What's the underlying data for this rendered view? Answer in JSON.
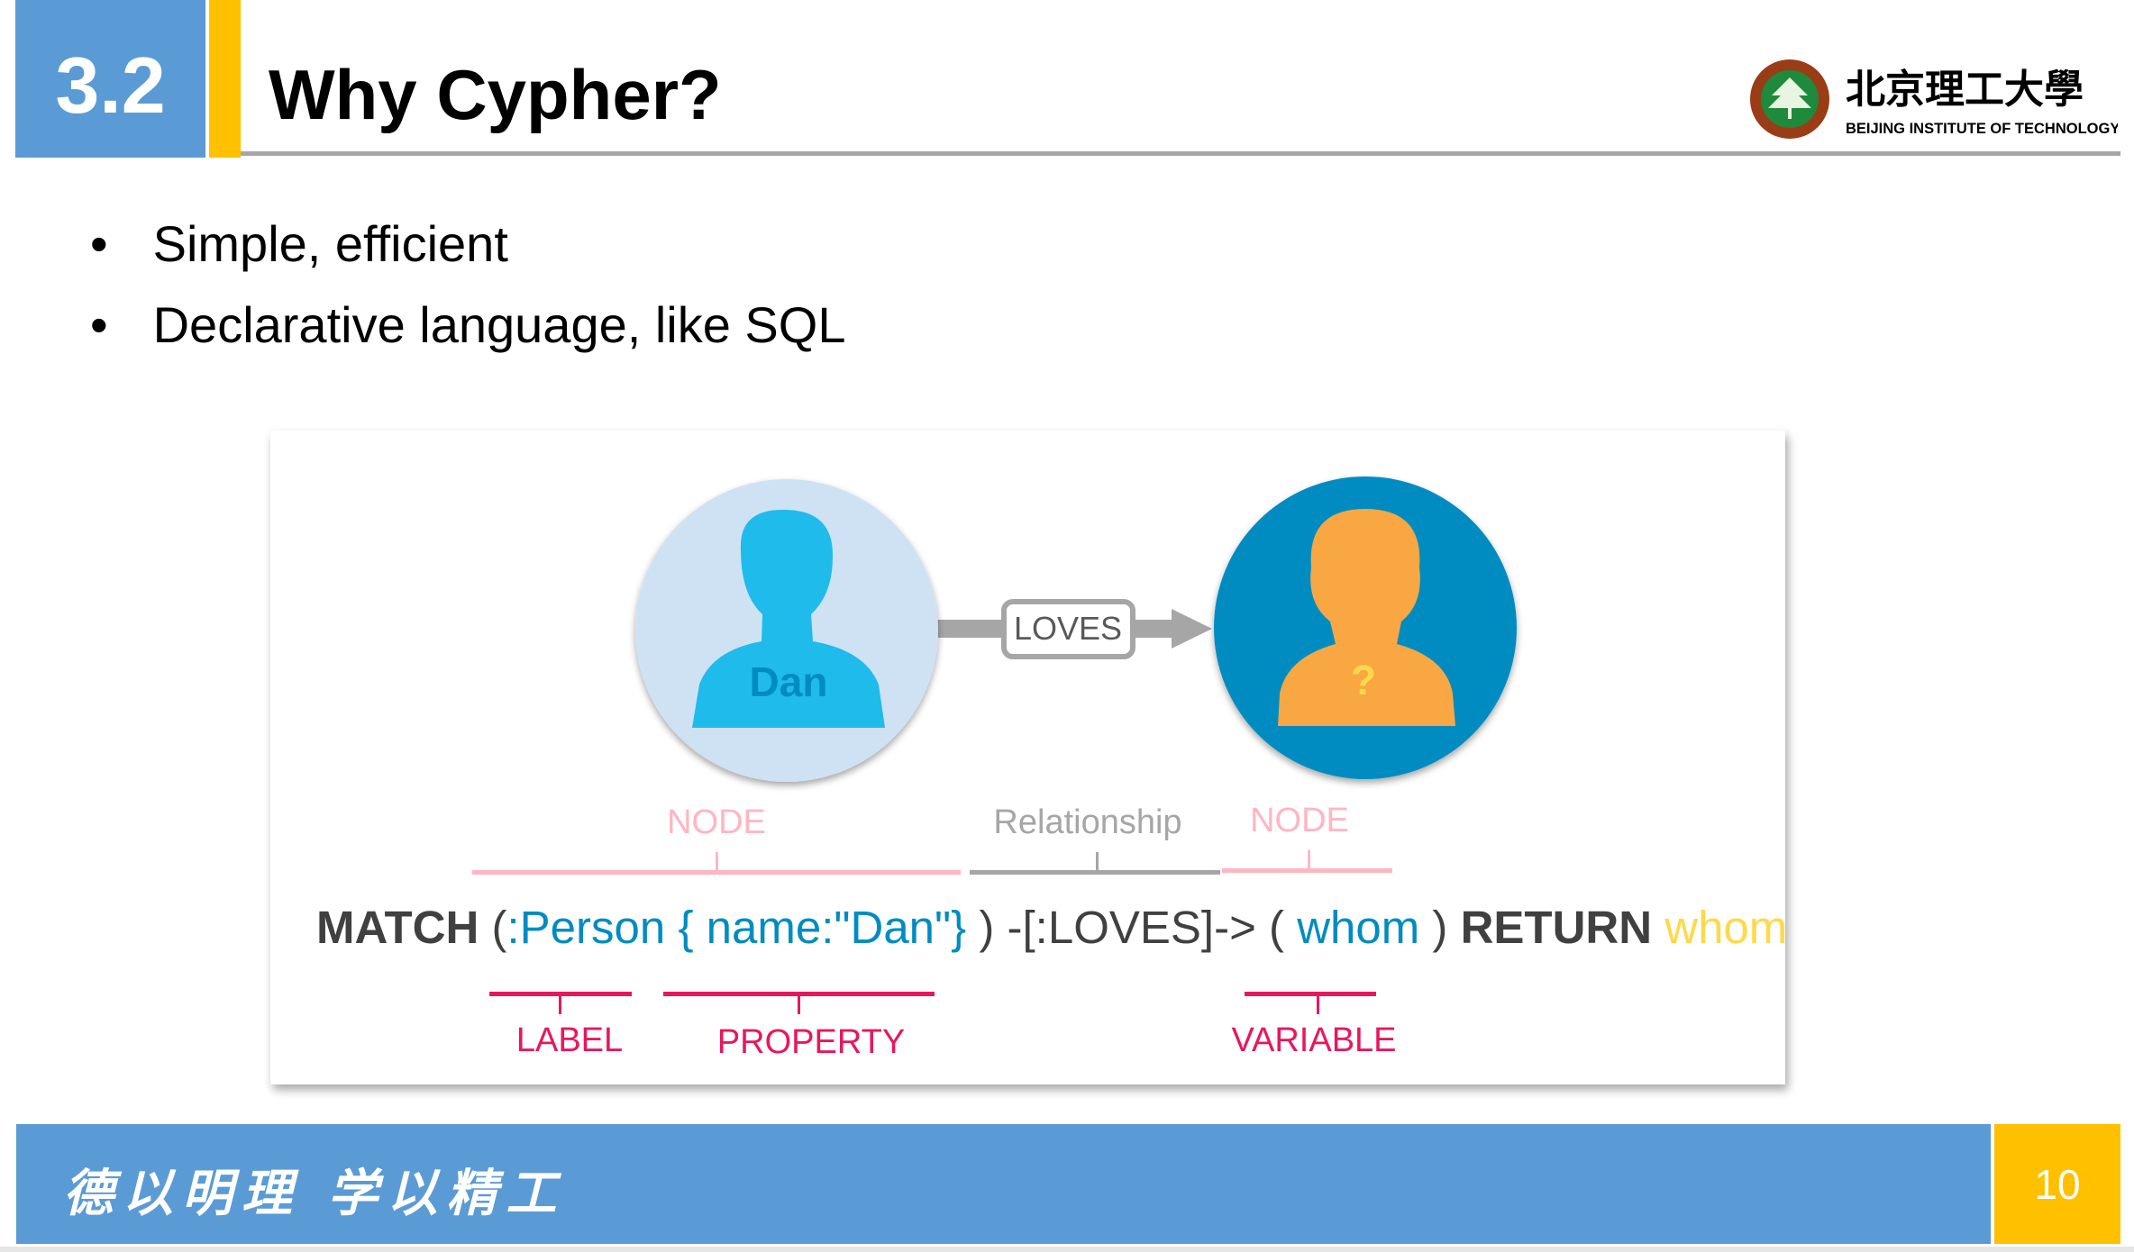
{
  "header": {
    "section_number": "3.2",
    "title": "Why Cypher?",
    "logo": {
      "name_cn": "北京理工大學",
      "name_en": "BEIJING INSTITUTE OF TECHNOLOGY",
      "seal_text": "BEIJING INSTITUTE OF TECHNOLOGY"
    }
  },
  "bullets": [
    "Simple, efficient",
    "Declarative language, like SQL"
  ],
  "diagram": {
    "node1_label": "Dan",
    "node2_label": "?",
    "relationship_label": "LOVES",
    "top_labels": {
      "node1": "NODE",
      "relationship": "Relationship",
      "node2": "NODE"
    },
    "code": {
      "match": "MATCH",
      "open1": "(",
      ":person": ":Person",
      "property": "{ name:\"Dan\"}",
      "close1": ")",
      "rel": "-[:LOVES]->",
      "open2": "(",
      "variable": "whom",
      "close2": ")",
      "return": "RETURN",
      "return_var": "whom"
    },
    "bottom_labels": {
      "label": "LABEL",
      "property": "PROPERTY",
      "variable": "VARIABLE"
    },
    "colors": {
      "node1_fill": "#cfe2f3",
      "person1": "#1fbbea",
      "node2_fill": "#008cc1",
      "person2": "#f9a742",
      "node_label": "#ffb6c1",
      "relationship": "#a6a6a6",
      "annotation": "#e8175d",
      "keyword": "#404040",
      "identifier": "#008cc1",
      "return_var": "#ffd94a"
    }
  },
  "footer": {
    "motto": "德以明理 学以精工",
    "page_number": "10"
  }
}
